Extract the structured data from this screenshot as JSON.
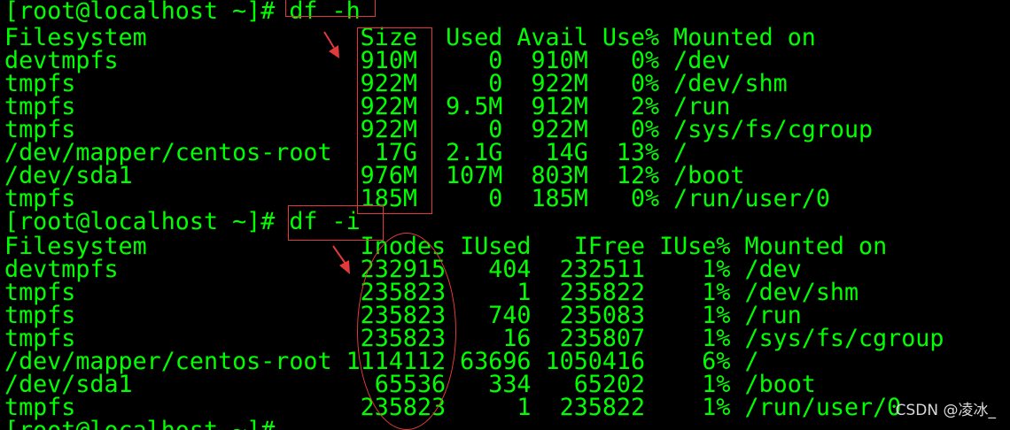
{
  "terminal": {
    "lines": [
      "[root@localhost ~]# df -h",
      "Filesystem               Size  Used Avail Use% Mounted on",
      "devtmpfs                 910M     0  910M   0% /dev",
      "tmpfs                    922M     0  922M   0% /dev/shm",
      "tmpfs                    922M  9.5M  912M   2% /run",
      "tmpfs                    922M     0  922M   0% /sys/fs/cgroup",
      "/dev/mapper/centos-root   17G  2.1G   14G  13% /",
      "/dev/sda1                976M  107M  803M  12% /boot",
      "tmpfs                    185M     0  185M   0% /run/user/0",
      "[root@localhost ~]# df -i",
      "Filesystem               Inodes IUsed   IFree IUse% Mounted on",
      "devtmpfs                 232915   404  232511    1% /dev",
      "tmpfs                    235823     1  235822    1% /dev/shm",
      "tmpfs                    235823   740  235083    1% /run",
      "tmpfs                    235823    16  235807    1% /sys/fs/cgroup",
      "/dev/mapper/centos-root 1114112 63696 1050416    6% /",
      "/dev/sda1                 65536   334   65202    1% /boot",
      "tmpfs                    235823     1  235822    1% /run/user/0",
      "[root@localhost ~]#"
    ],
    "text_color": "#00ff00",
    "background": "#000000"
  },
  "annotations": {
    "color": "#e23a3a"
  },
  "watermark": {
    "text": "CSDN @凌冰_"
  }
}
